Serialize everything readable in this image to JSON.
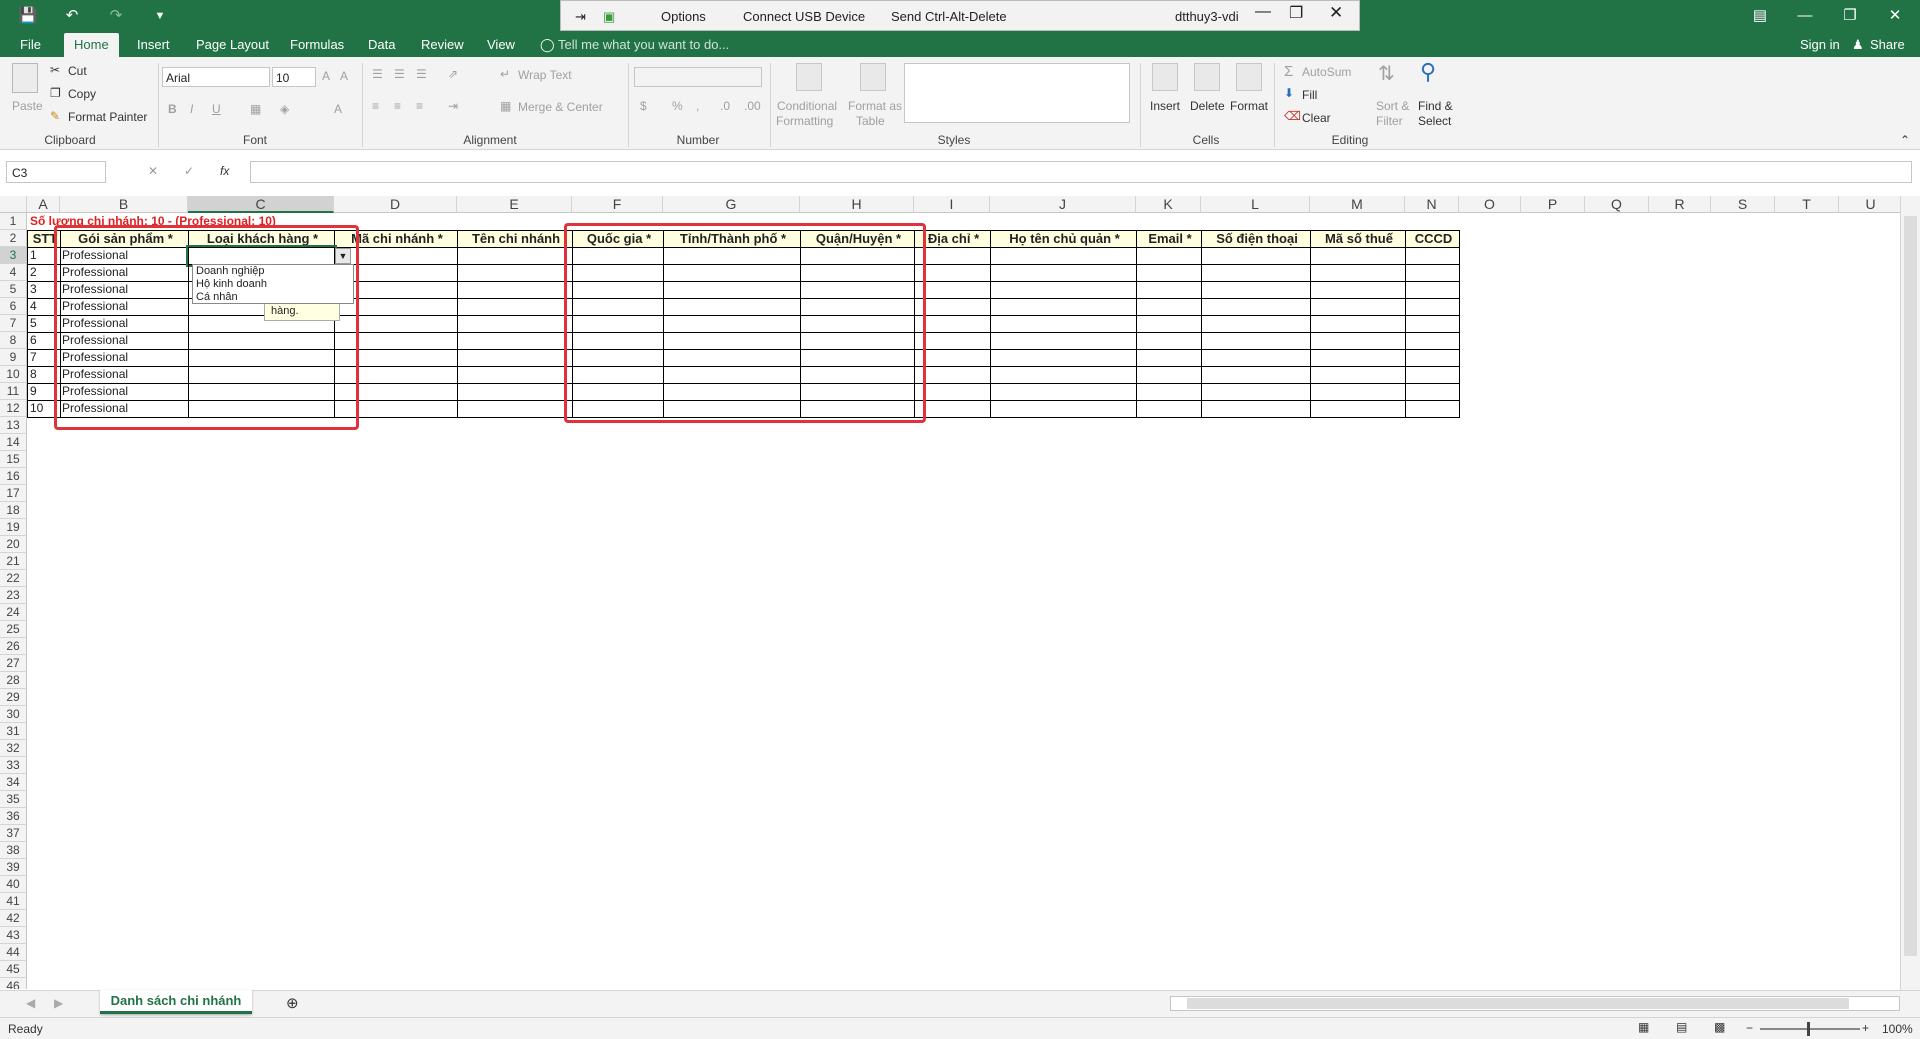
{
  "titlebar": {
    "save_icon": "save-icon",
    "undo_icon": "undo-icon",
    "redo_icon": "redo-icon",
    "customize_icon": "customize-icon",
    "vdi": {
      "options_label": "Options",
      "usb_label": "Connect USB Device",
      "ctrl_alt_del_label": "Send Ctrl-Alt-Delete",
      "session_title": "dtthuy3-vdi"
    }
  },
  "ribbon_tabs": {
    "file": "File",
    "home": "Home",
    "insert": "Insert",
    "page_layout": "Page Layout",
    "formulas": "Formulas",
    "data": "Data",
    "review": "Review",
    "view": "View",
    "tell_me": "Tell me what you want to do...",
    "sign_in": "Sign in",
    "share": "Share"
  },
  "ribbon": {
    "clipboard": {
      "paste": "Paste",
      "cut": "Cut",
      "copy": "Copy",
      "format_painter": "Format Painter",
      "label": "Clipboard"
    },
    "font": {
      "name": "Arial",
      "size": "10",
      "label": "Font"
    },
    "alignment": {
      "wrap_text": "Wrap Text",
      "merge_center": "Merge & Center",
      "label": "Alignment"
    },
    "number": {
      "label": "Number"
    },
    "styles": {
      "conditional": "Conditional",
      "formatting": "Formatting",
      "format_as": "Format as",
      "table": "Table",
      "label": "Styles"
    },
    "cells": {
      "insert": "Insert",
      "delete": "Delete",
      "format": "Format",
      "label": "Cells"
    },
    "editing": {
      "autosum": "AutoSum",
      "fill": "Fill",
      "clear": "Clear",
      "sort": "Sort &",
      "filter": "Filter",
      "find": "Find &",
      "select": "Select",
      "label": "Editing"
    }
  },
  "formula_bar": {
    "name_box": "C3",
    "fx": "fx",
    "value": ""
  },
  "columns": [
    "A",
    "B",
    "C",
    "D",
    "E",
    "F",
    "G",
    "H",
    "I",
    "J",
    "K",
    "L",
    "M",
    "N",
    "O",
    "P",
    "Q",
    "R",
    "S",
    "T",
    "U"
  ],
  "sheet": {
    "a1_text": "Số lượng chi nhánh: 10 - (Professional: 10)",
    "headers": [
      "STT",
      "Gói sản phẩm *",
      "Loại khách hàng *",
      "Mã chi nhánh *",
      "Tên chi nhánh",
      "Quốc gia *",
      "Tỉnh/Thành phố *",
      "Quận/Huyện *",
      "Địa chỉ *",
      "Họ tên chủ quản *",
      "Email *",
      "Số điện thoại",
      "Mã số thuế",
      "CCCD"
    ],
    "rows": [
      {
        "stt": "1",
        "goi": "Professional"
      },
      {
        "stt": "2",
        "goi": "Professional"
      },
      {
        "stt": "3",
        "goi": "Professional"
      },
      {
        "stt": "4",
        "goi": "Professional"
      },
      {
        "stt": "5",
        "goi": "Professional"
      },
      {
        "stt": "6",
        "goi": "Professional"
      },
      {
        "stt": "7",
        "goi": "Professional"
      },
      {
        "stt": "8",
        "goi": "Professional"
      },
      {
        "stt": "9",
        "goi": "Professional"
      },
      {
        "stt": "10",
        "goi": "Professional"
      }
    ],
    "dropdown_options": [
      "Doanh nghiệp",
      "Hộ kinh doanh",
      "Cá nhân"
    ],
    "tooltip": "hàng."
  },
  "sheet_tab": "Danh sách chi nhánh",
  "status": {
    "ready": "Ready",
    "zoom": "100%"
  }
}
